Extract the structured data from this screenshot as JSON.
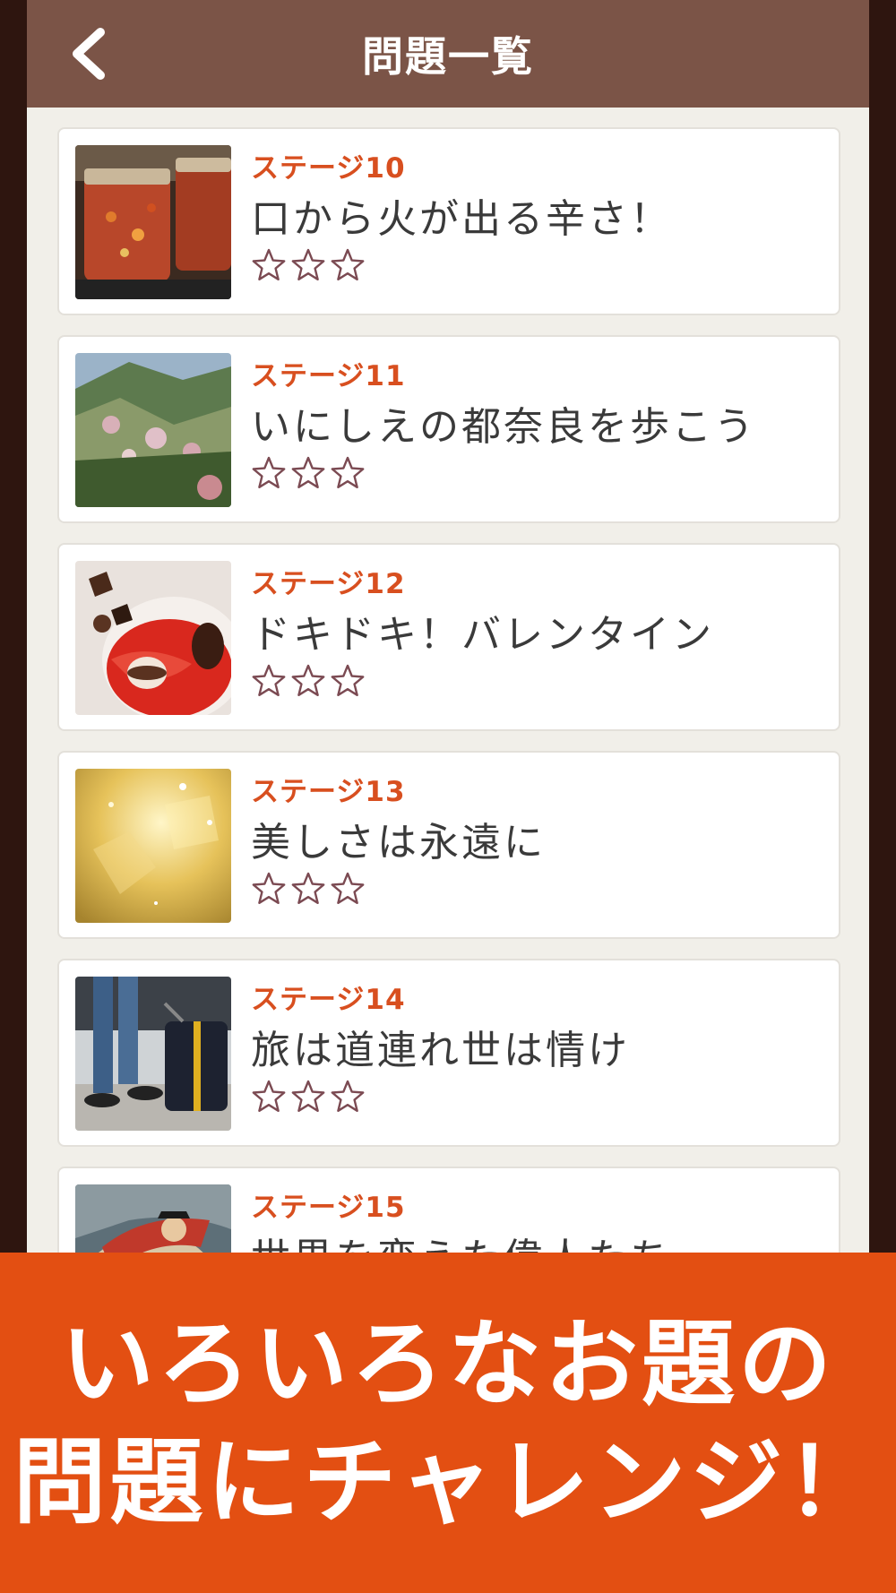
{
  "header": {
    "title": "問題一覧",
    "back_icon": "chevron-left-icon"
  },
  "stages": [
    {
      "label": "ステージ10",
      "title": "口から火が出る辛さ！",
      "stars_filled": 0,
      "stars_total": 3,
      "thumbnail": "chili-jars"
    },
    {
      "label": "ステージ11",
      "title": "いにしえの都奈良を歩こう",
      "stars_filled": 0,
      "stars_total": 3,
      "thumbnail": "mountain-village"
    },
    {
      "label": "ステージ12",
      "title": "ドキドキ！バレンタイン",
      "stars_filled": 0,
      "stars_total": 3,
      "thumbnail": "chocolates"
    },
    {
      "label": "ステージ13",
      "title": "美しさは永遠に",
      "stars_filled": 0,
      "stars_total": 3,
      "thumbnail": "gold-sparkles"
    },
    {
      "label": "ステージ14",
      "title": "旅は道連れ世は情け",
      "stars_filled": 0,
      "stars_total": 3,
      "thumbnail": "traveler-suitcase"
    },
    {
      "label": "ステージ15",
      "title": "世界を変えた偉人たち",
      "stars_filled": 0,
      "stars_total": 3,
      "thumbnail": "napoleon-painting"
    }
  ],
  "banner": {
    "line1": "いろいろなお題の",
    "line2": "問題にチャレンジ！"
  },
  "colors": {
    "header_bg": "#7b5447",
    "stage_label": "#d84f1f",
    "banner_bg": "#e34f12",
    "star_outline": "#7b4a52",
    "page_bg": "#f1efe9",
    "frame": "#2e150f"
  }
}
